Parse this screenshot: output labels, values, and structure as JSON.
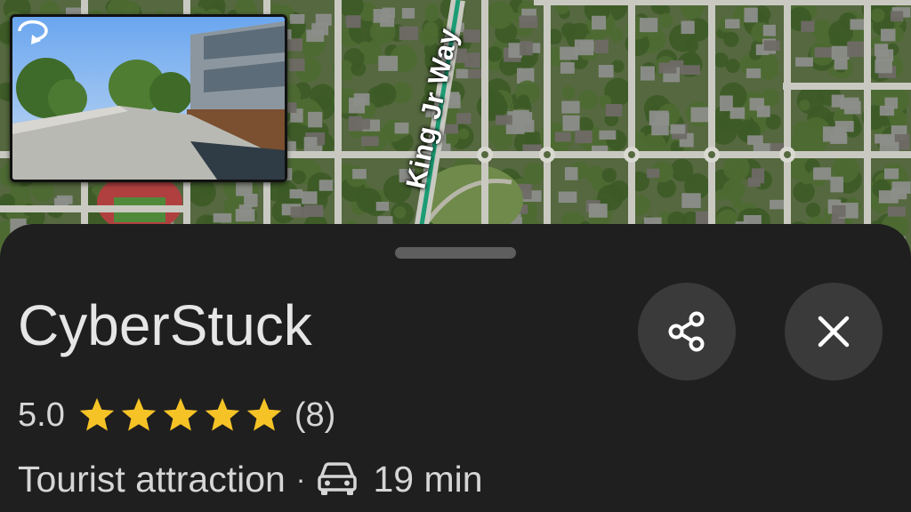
{
  "map": {
    "road_label": "King Jr Way",
    "colors": {
      "road": "#c9c9c2",
      "vegetation": "#4e6a32",
      "roof": "#8c8e8a",
      "highlight_road": "#1c9c74"
    }
  },
  "street_view": {
    "icon": "rotate-360-icon"
  },
  "place": {
    "name": "CyberStuck",
    "rating": "5.0",
    "stars": 5,
    "review_count": "(8)",
    "category": "Tourist attraction",
    "separator": "·",
    "travel_mode_icon": "car-icon",
    "travel_time": "19 min"
  },
  "actions": {
    "share_icon": "share-icon",
    "close_icon": "close-icon"
  },
  "colors": {
    "star": "#f6c326",
    "sheet_bg": "#1f1f1f",
    "button_bg": "#3a3a3a",
    "text": "#e6e6e6"
  }
}
